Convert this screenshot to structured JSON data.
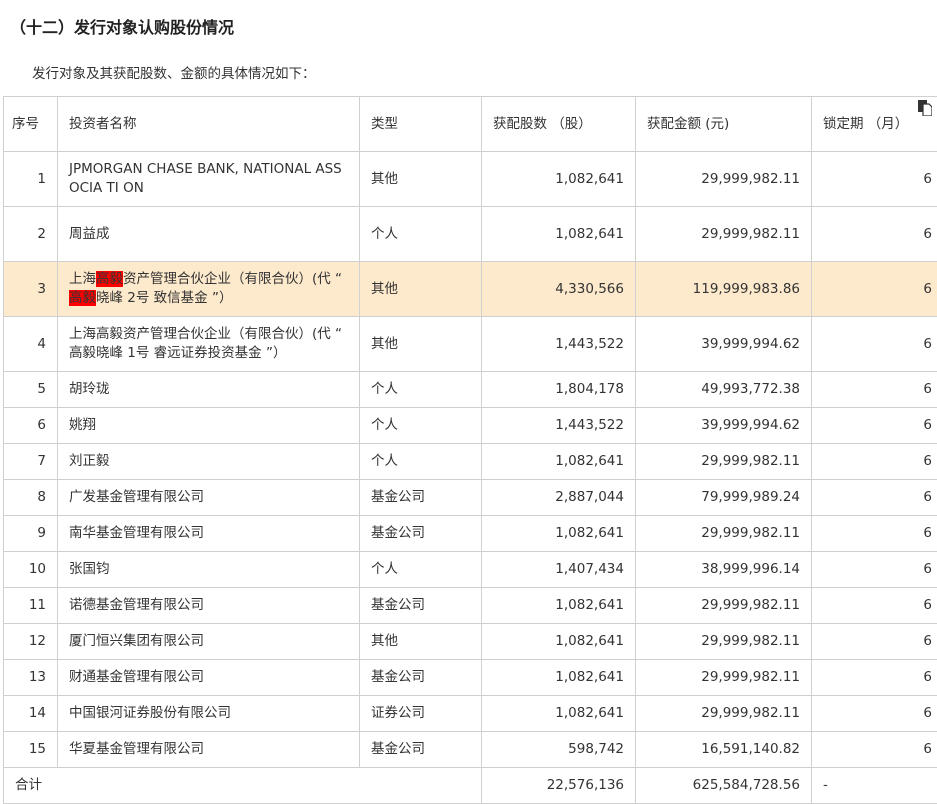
{
  "title": "（十二）发行对象认购股份情况",
  "intro": "发行对象及其获配股数、金额的具体情况如下：",
  "headers": {
    "no": "序号",
    "name": "投资者名称",
    "type": "类型",
    "shares": "获配股数 （股）",
    "amount": "获配金额 (元)",
    "lock": "锁定期 （月）"
  },
  "rows": [
    {
      "no": "1",
      "name": "JPMORGAN CHASE BANK, NATIONAL ASS OCIA TI ON",
      "type": "其他",
      "shares": "1,082,641",
      "amount": "29,999,982.11",
      "lock": "6"
    },
    {
      "no": "2",
      "name": "周益成",
      "type": "个人",
      "shares": "1,082,641",
      "amount": "29,999,982.11",
      "lock": "6"
    },
    {
      "no": "3",
      "name_parts": [
        "上海",
        "高毅",
        "资产管理合伙企业（有限合伙）(代 “ ",
        "高毅",
        "晓峰 2号 致信基金 ”）"
      ],
      "type": "其他",
      "shares": "4,330,566",
      "amount": "119,999,983.86",
      "lock": "6"
    },
    {
      "no": "4",
      "name": "上海高毅资产管理合伙企业（有限合伙）(代 “ 高毅晓峰 1号 睿远证券投资基金 ”）",
      "type": "其他",
      "shares": "1,443,522",
      "amount": "39,999,994.62",
      "lock": "6"
    },
    {
      "no": "5",
      "name": "胡玲珑",
      "type": "个人",
      "shares": "1,804,178",
      "amount": "49,993,772.38",
      "lock": "6"
    },
    {
      "no": "6",
      "name": "姚翔",
      "type": "个人",
      "shares": "1,443,522",
      "amount": "39,999,994.62",
      "lock": "6"
    },
    {
      "no": "7",
      "name": "刘正毅",
      "type": "个人",
      "shares": "1,082,641",
      "amount": "29,999,982.11",
      "lock": "6"
    },
    {
      "no": "8",
      "name": "广发基金管理有限公司",
      "type": "基金公司",
      "shares": "2,887,044",
      "amount": "79,999,989.24",
      "lock": "6"
    },
    {
      "no": "9",
      "name": "南华基金管理有限公司",
      "type": "基金公司",
      "shares": "1,082,641",
      "amount": "29,999,982.11",
      "lock": "6"
    },
    {
      "no": "10",
      "name": "张国钧",
      "type": "个人",
      "shares": "1,407,434",
      "amount": "38,999,996.14",
      "lock": "6"
    },
    {
      "no": "11",
      "name": "诺德基金管理有限公司",
      "type": "基金公司",
      "shares": "1,082,641",
      "amount": "29,999,982.11",
      "lock": "6"
    },
    {
      "no": "12",
      "name": "厦门恒兴集团有限公司",
      "type": "其他",
      "shares": "1,082,641",
      "amount": "29,999,982.11",
      "lock": "6"
    },
    {
      "no": "13",
      "name": "财通基金管理有限公司",
      "type": "基金公司",
      "shares": "1,082,641",
      "amount": "29,999,982.11",
      "lock": "6"
    },
    {
      "no": "14",
      "name": "中国银河证券股份有限公司",
      "type": "证券公司",
      "shares": "1,082,641",
      "amount": "29,999,982.11",
      "lock": "6"
    },
    {
      "no": "15",
      "name": "华夏基金管理有限公司",
      "type": "基金公司",
      "shares": "598,742",
      "amount": "16,591,140.82",
      "lock": "6"
    }
  ],
  "total": {
    "label": "合计",
    "shares": "22,576,136",
    "amount": "625,584,728.56",
    "lock": "-"
  },
  "colors": {
    "highlight_row": "#fde9cc",
    "mark": "#ff0000"
  }
}
